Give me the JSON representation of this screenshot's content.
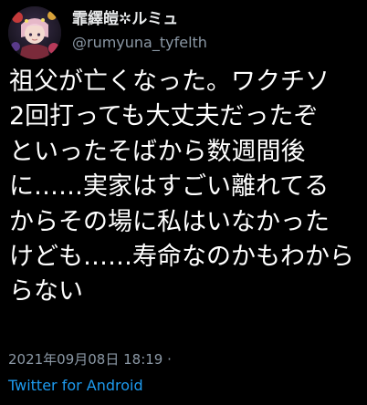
{
  "author": {
    "display_name": "霏繹皚✲ルミュ",
    "handle": "@rumyuna_tyfelth"
  },
  "tweet": {
    "lines": [
      "祖父が亡くなった。ワクチソ",
      "2回打っても大丈夫だったぞ",
      "といったそばから数週間後",
      "に……実家はすごい離れてる",
      "からその場に私はいなかった",
      "けども……寿命なのかもわから",
      "らない"
    ]
  },
  "meta": {
    "timestamp": "2021年09月08日 18:19 ·",
    "source": "Twitter for Android"
  },
  "colors": {
    "background": "#000000",
    "text": "#ffffff",
    "muted": "#8b98a5",
    "link": "#1d9bf0"
  },
  "icons": {
    "avatar": "anime-character-avatar"
  }
}
